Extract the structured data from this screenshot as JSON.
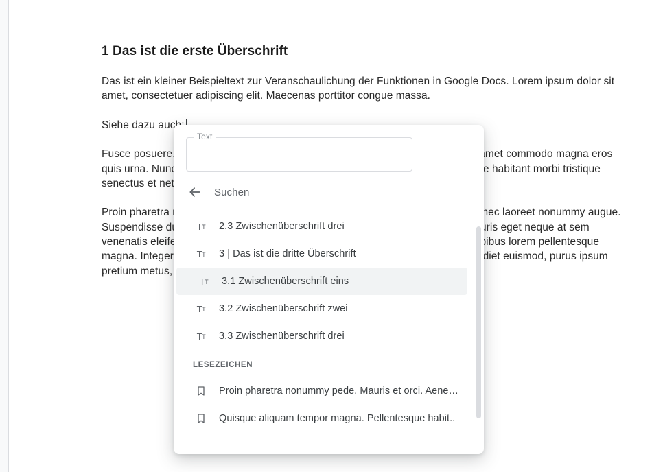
{
  "document": {
    "heading_number": "1",
    "heading_text": "Das ist die erste Überschrift",
    "heading_full": "1 Das ist die erste Überschrift",
    "para1": "Das ist ein kleiner Beispieltext zur Veranschaulichung der Funktionen in Google Docs. Lorem ipsum dolor sit amet, consectetuer adipiscing elit. Maecenas porttitor congue massa.",
    "para2_prefix": "Siehe dazu auch:",
    "para3": "Fusce posuere, magna sed pulvinar ultricies, purus lectus malesuada libero, sit amet commodo magna eros quis urna. Nunc viverra imperdiet enim. Fusce est. Vivamus a tellus. Pellentesque habitant morbi tristique senectus et netus et malesuada fames ac turpis egestas.",
    "para4": "Proin pharetra nonummy pede. Mauris et orci. Aenean nec lorem. In porttitor. Donec laoreet nonummy augue. Suspendisse dui purus, scelerisque at, vulputate vitae, pretium mattis, nunc. Mauris eget neque at sem venenatis eleifend. Ut nonummy. Fusce aliquet pede non pede. Suspendisse dapibus lorem pellentesque magna. Integer nulla. Donec blandit feugiat ligula. Donec hendrerit, felis et imperdiet euismod, purus ipsum pretium metus, in lacinia nulla nisl eget sapien."
  },
  "popup": {
    "text_field_label": "Text",
    "text_field_value": "",
    "search_label": "Suchen",
    "section_bookmarks": "LESEZEICHEN",
    "items": {
      "h23": "2.3 Zwischenüberschrift drei",
      "h3": "3 | Das ist die dritte Überschrift",
      "h31": "3.1 Zwischenüberschrift eins",
      "h32": "3.2 Zwischenüberschrift zwei",
      "h33": "3.3 Zwischenüberschrift drei"
    },
    "bookmarks": {
      "b1": "Proin pharetra nonummy pede. Mauris et orci. Aene…",
      "b2": "Quisque aliquam tempor magna. Pellentesque habit.."
    }
  }
}
